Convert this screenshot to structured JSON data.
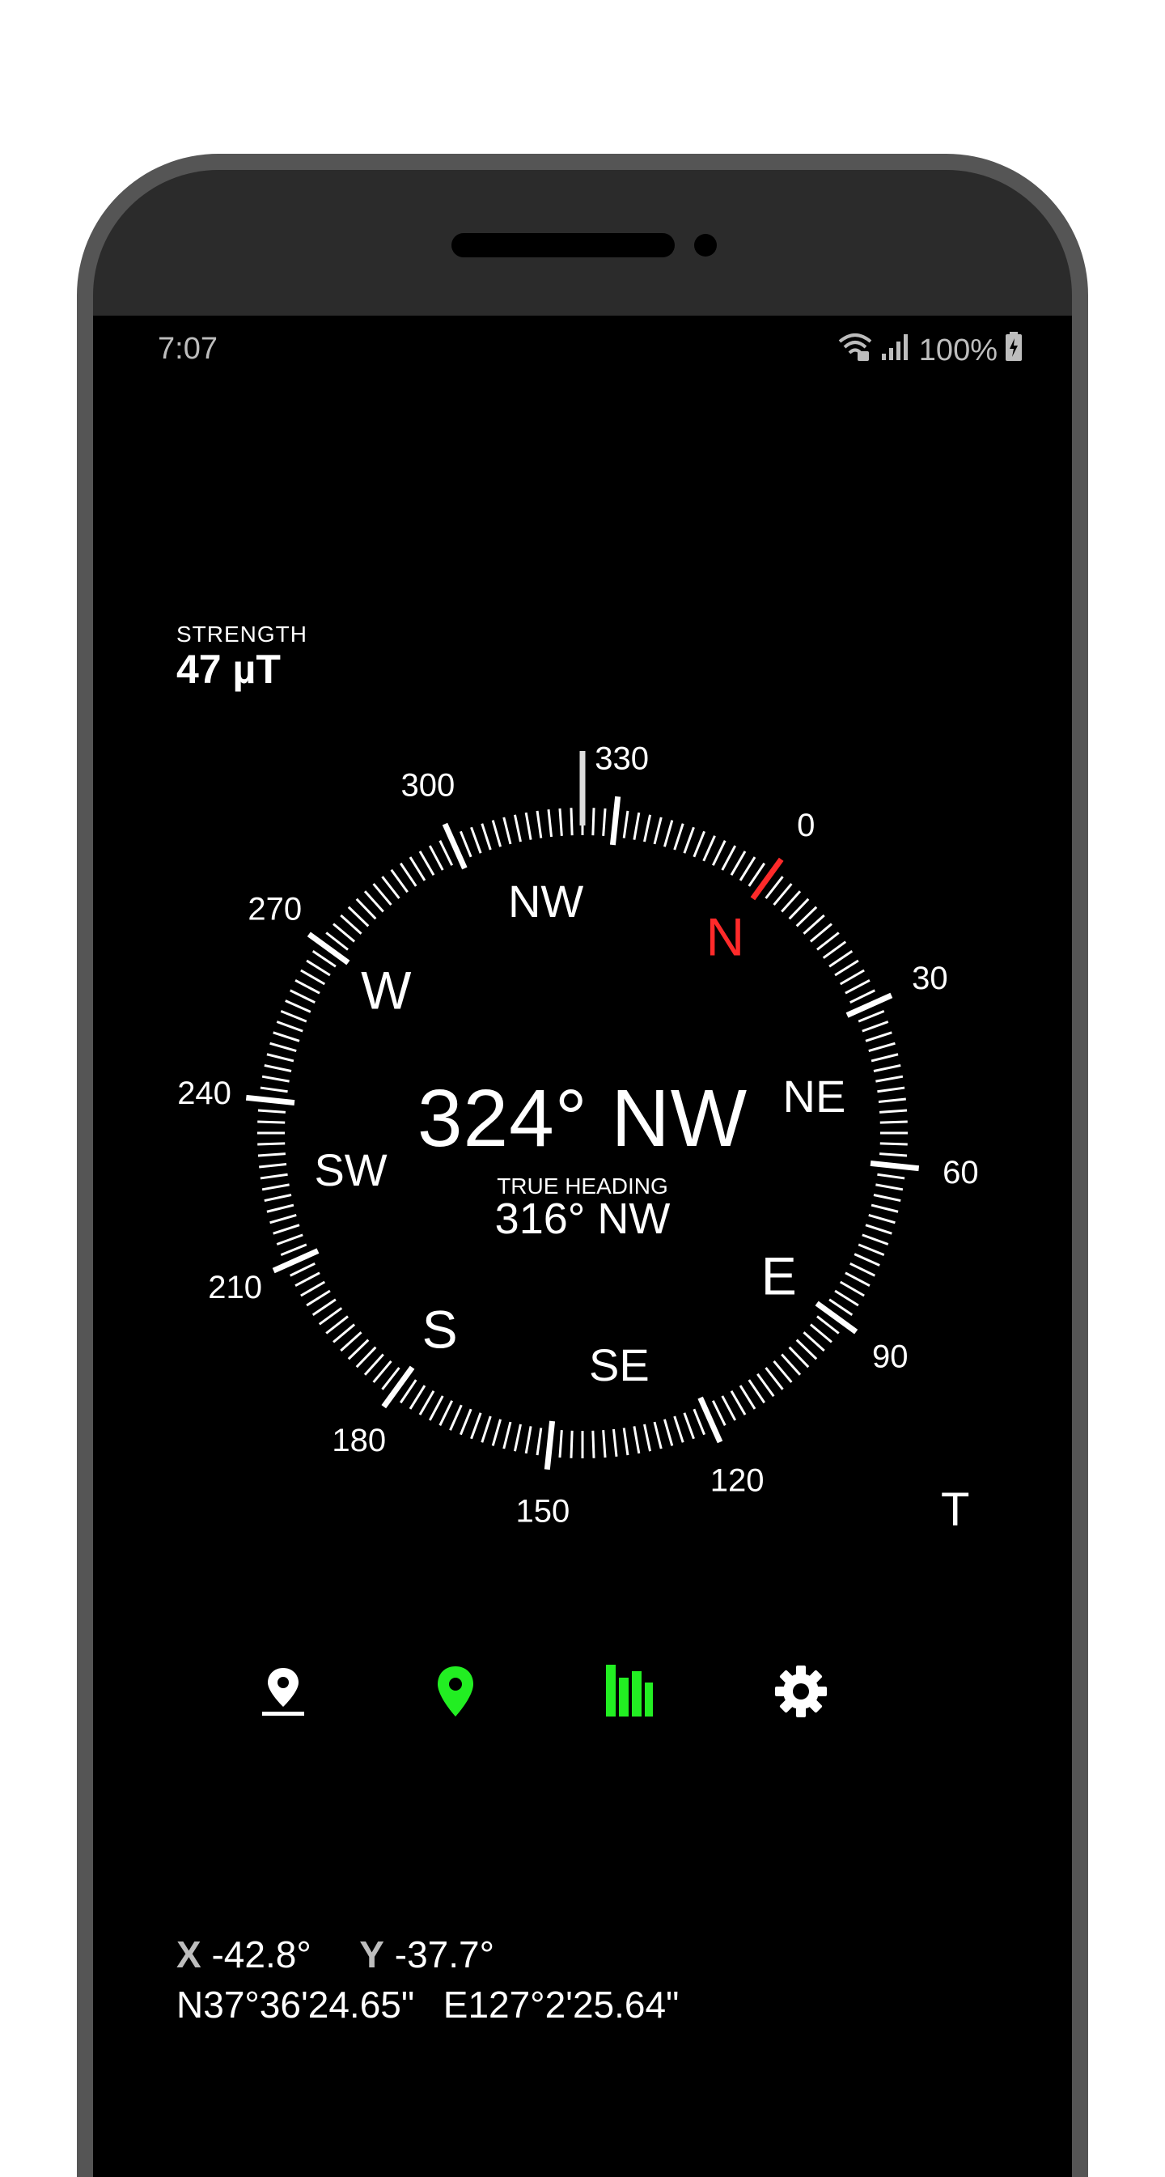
{
  "status_bar": {
    "time": "7:07",
    "battery": "100%"
  },
  "strength": {
    "label": "STRENGTH",
    "value": "47 µT"
  },
  "compass": {
    "heading_deg": 324,
    "cardinals": [
      {
        "label": "N",
        "angle": 0,
        "color": "#ff2a2a"
      },
      {
        "label": "NE",
        "angle": 45,
        "color": "#ffffff"
      },
      {
        "label": "E",
        "angle": 90,
        "color": "#ffffff"
      },
      {
        "label": "SE",
        "angle": 135,
        "color": "#ffffff"
      },
      {
        "label": "S",
        "angle": 180,
        "color": "#ffffff"
      },
      {
        "label": "SW",
        "angle": 225,
        "color": "#ffffff"
      },
      {
        "label": "W",
        "angle": 270,
        "color": "#ffffff"
      },
      {
        "label": "NW",
        "angle": 315,
        "color": "#ffffff"
      }
    ],
    "degree_labels": [
      "0",
      "30",
      "60",
      "90",
      "120",
      "150",
      "180",
      "210",
      "240",
      "270",
      "300",
      "330"
    ],
    "north_marker_color": "#ff2a2a",
    "heading": "324° NW",
    "true_heading_label": "TRUE HEADING",
    "true_heading": "316° NW",
    "t_label": "T"
  },
  "toolbar": [
    {
      "name": "location-pin-outline-icon",
      "color": "#ffffff"
    },
    {
      "name": "location-pin-filled-icon",
      "color": "#22ee22"
    },
    {
      "name": "bar-chart-icon",
      "color": "#22ee22"
    },
    {
      "name": "gear-icon",
      "color": "#ffffff"
    }
  ],
  "tilt": {
    "x_key": "X",
    "x_value": "-42.8°",
    "y_key": "Y",
    "y_value": "-37.7°"
  },
  "coordinates": {
    "lat_key": "N",
    "lat_value": "37°36'24.65\"",
    "lon_key": "E",
    "lon_value": "127°2'25.64\""
  }
}
